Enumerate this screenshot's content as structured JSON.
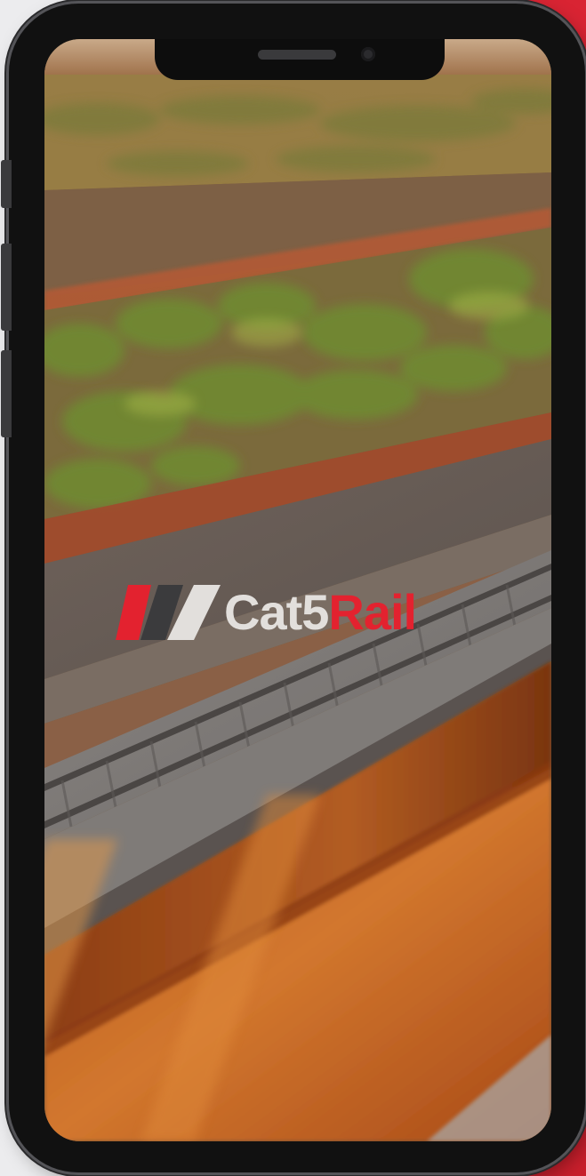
{
  "screen": {
    "brand": {
      "name_part1": "Cat5",
      "name_part2": "Rail",
      "colors": {
        "red": "#e3222f",
        "dark": "#3b3b3d",
        "light": "#e2dfdc"
      }
    }
  },
  "device": {
    "frame_color": "#111111",
    "accent_color": "#d92433"
  },
  "icons": {
    "logo_mark": "cat5rail-parallelograms-icon",
    "camera": "front-camera-icon",
    "speaker": "earpiece-speaker-icon"
  }
}
